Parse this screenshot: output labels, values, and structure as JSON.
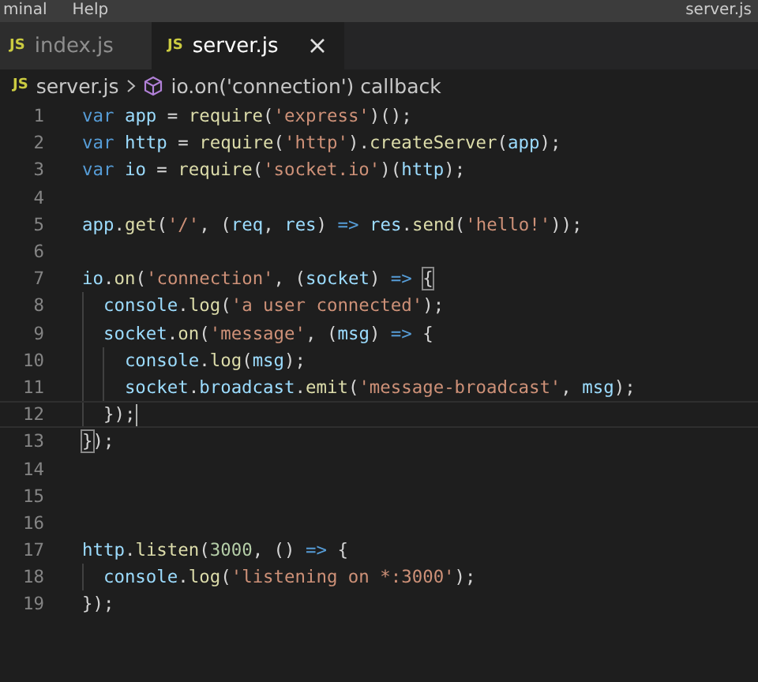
{
  "menu_bar": {
    "items": [
      "minal",
      "Help"
    ],
    "title": "server.js"
  },
  "tabs": [
    {
      "label": "index.js",
      "icon": "JS",
      "selected": false
    },
    {
      "label": "server.js",
      "icon": "JS",
      "selected": true
    }
  ],
  "breadcrumbs": {
    "icon": "JS",
    "file": "server.js",
    "symbol": "io.on('connection') callback"
  },
  "lines": [
    {
      "number": "1",
      "current": false,
      "tokens": [
        {
          "kind": "keyword",
          "text": "var "
        },
        {
          "kind": "variable",
          "text": "app"
        },
        {
          "kind": "plain",
          "text": " = "
        },
        {
          "kind": "function",
          "text": "require"
        },
        {
          "kind": "plain",
          "text": "("
        },
        {
          "kind": "string",
          "text": "'express'"
        },
        {
          "kind": "plain",
          "text": ")();"
        }
      ]
    },
    {
      "number": "2",
      "current": false,
      "tokens": [
        {
          "kind": "keyword",
          "text": "var "
        },
        {
          "kind": "variable",
          "text": "http"
        },
        {
          "kind": "plain",
          "text": " = "
        },
        {
          "kind": "function",
          "text": "require"
        },
        {
          "kind": "plain",
          "text": "("
        },
        {
          "kind": "string",
          "text": "'http'"
        },
        {
          "kind": "plain",
          "text": ")."
        },
        {
          "kind": "function",
          "text": "createServer"
        },
        {
          "kind": "plain",
          "text": "("
        },
        {
          "kind": "variable",
          "text": "app"
        },
        {
          "kind": "plain",
          "text": ");"
        }
      ]
    },
    {
      "number": "3",
      "current": false,
      "tokens": [
        {
          "kind": "keyword",
          "text": "var "
        },
        {
          "kind": "variable",
          "text": "io"
        },
        {
          "kind": "plain",
          "text": " = "
        },
        {
          "kind": "function",
          "text": "require"
        },
        {
          "kind": "plain",
          "text": "("
        },
        {
          "kind": "string",
          "text": "'socket.io'"
        },
        {
          "kind": "plain",
          "text": ")("
        },
        {
          "kind": "variable",
          "text": "http"
        },
        {
          "kind": "plain",
          "text": ");"
        }
      ]
    },
    {
      "number": "4",
      "current": false
    },
    {
      "number": "5",
      "current": false,
      "tokens": [
        {
          "kind": "variable",
          "text": "app"
        },
        {
          "kind": "plain",
          "text": "."
        },
        {
          "kind": "function",
          "text": "get"
        },
        {
          "kind": "plain",
          "text": "("
        },
        {
          "kind": "string",
          "text": "'/'"
        },
        {
          "kind": "plain",
          "text": ", ("
        },
        {
          "kind": "variable",
          "text": "req"
        },
        {
          "kind": "plain",
          "text": ", "
        },
        {
          "kind": "variable",
          "text": "res"
        },
        {
          "kind": "plain",
          "text": ") "
        },
        {
          "kind": "keyword",
          "text": "=> "
        },
        {
          "kind": "variable",
          "text": "res"
        },
        {
          "kind": "plain",
          "text": "."
        },
        {
          "kind": "function",
          "text": "send"
        },
        {
          "kind": "plain",
          "text": "("
        },
        {
          "kind": "string",
          "text": "'hello!'"
        },
        {
          "kind": "plain",
          "text": "));"
        }
      ]
    },
    {
      "number": "6",
      "current": false
    },
    {
      "number": "7",
      "current": false,
      "tokens": [
        {
          "kind": "variable",
          "text": "io"
        },
        {
          "kind": "plain",
          "text": "."
        },
        {
          "kind": "function",
          "text": "on"
        },
        {
          "kind": "plain",
          "text": "("
        },
        {
          "kind": "string",
          "text": "'connection'"
        },
        {
          "kind": "plain",
          "text": ", ("
        },
        {
          "kind": "variable",
          "text": "socket"
        },
        {
          "kind": "plain",
          "text": ") "
        },
        {
          "kind": "keyword",
          "text": "=> "
        },
        {
          "kind": "bracket",
          "text": "{"
        }
      ]
    },
    {
      "number": "8",
      "current": false,
      "tokens": [
        {
          "kind": "variable",
          "text": "  console"
        },
        {
          "kind": "plain",
          "text": "."
        },
        {
          "kind": "function",
          "text": "log"
        },
        {
          "kind": "plain",
          "text": "("
        },
        {
          "kind": "string",
          "text": "'a user connected'"
        },
        {
          "kind": "plain",
          "text": ");"
        }
      ]
    },
    {
      "number": "9",
      "current": false,
      "tokens": [
        {
          "kind": "variable",
          "text": "  socket"
        },
        {
          "kind": "plain",
          "text": "."
        },
        {
          "kind": "function",
          "text": "on"
        },
        {
          "kind": "plain",
          "text": "("
        },
        {
          "kind": "string",
          "text": "'message'"
        },
        {
          "kind": "plain",
          "text": ", ("
        },
        {
          "kind": "variable",
          "text": "msg"
        },
        {
          "kind": "plain",
          "text": ") "
        },
        {
          "kind": "keyword",
          "text": "=>"
        },
        {
          "kind": "plain",
          "text": " {"
        }
      ]
    },
    {
      "number": "10",
      "current": false,
      "tokens": [
        {
          "kind": "variable",
          "text": "    console"
        },
        {
          "kind": "plain",
          "text": "."
        },
        {
          "kind": "function",
          "text": "log"
        },
        {
          "kind": "plain",
          "text": "("
        },
        {
          "kind": "variable",
          "text": "msg"
        },
        {
          "kind": "plain",
          "text": ");"
        }
      ]
    },
    {
      "number": "11",
      "current": false,
      "tokens": [
        {
          "kind": "variable",
          "text": "    socket"
        },
        {
          "kind": "plain",
          "text": "."
        },
        {
          "kind": "variable",
          "text": "broadcast"
        },
        {
          "kind": "plain",
          "text": "."
        },
        {
          "kind": "function",
          "text": "emit"
        },
        {
          "kind": "plain",
          "text": "("
        },
        {
          "kind": "string",
          "text": "'message-broadcast'"
        },
        {
          "kind": "plain",
          "text": ", "
        },
        {
          "kind": "variable",
          "text": "msg"
        },
        {
          "kind": "plain",
          "text": ");"
        }
      ]
    },
    {
      "number": "12",
      "current": true,
      "tokens": [
        {
          "kind": "plain",
          "text": "  });"
        }
      ]
    },
    {
      "number": "13",
      "current": false,
      "tokens": [
        {
          "kind": "bracket",
          "text": "}"
        },
        {
          "kind": "plain",
          "text": ");"
        }
      ]
    },
    {
      "number": "14",
      "current": false
    },
    {
      "number": "15",
      "current": false
    },
    {
      "number": "16",
      "current": false
    },
    {
      "number": "17",
      "current": false,
      "tokens": [
        {
          "kind": "variable",
          "text": "http"
        },
        {
          "kind": "plain",
          "text": "."
        },
        {
          "kind": "function",
          "text": "listen"
        },
        {
          "kind": "plain",
          "text": "("
        },
        {
          "kind": "number",
          "text": "3000"
        },
        {
          "kind": "plain",
          "text": ", () "
        },
        {
          "kind": "keyword",
          "text": "=>"
        },
        {
          "kind": "plain",
          "text": " {"
        }
      ]
    },
    {
      "number": "18",
      "current": false,
      "tokens": [
        {
          "kind": "variable",
          "text": "  console"
        },
        {
          "kind": "plain",
          "text": "."
        },
        {
          "kind": "function",
          "text": "log"
        },
        {
          "kind": "plain",
          "text": "("
        },
        {
          "kind": "string",
          "text": "'listening on *:3000'"
        },
        {
          "kind": "plain",
          "text": ");"
        }
      ]
    },
    {
      "number": "19",
      "current": false,
      "tokens": [
        {
          "kind": "plain",
          "text": "});"
        }
      ]
    }
  ]
}
